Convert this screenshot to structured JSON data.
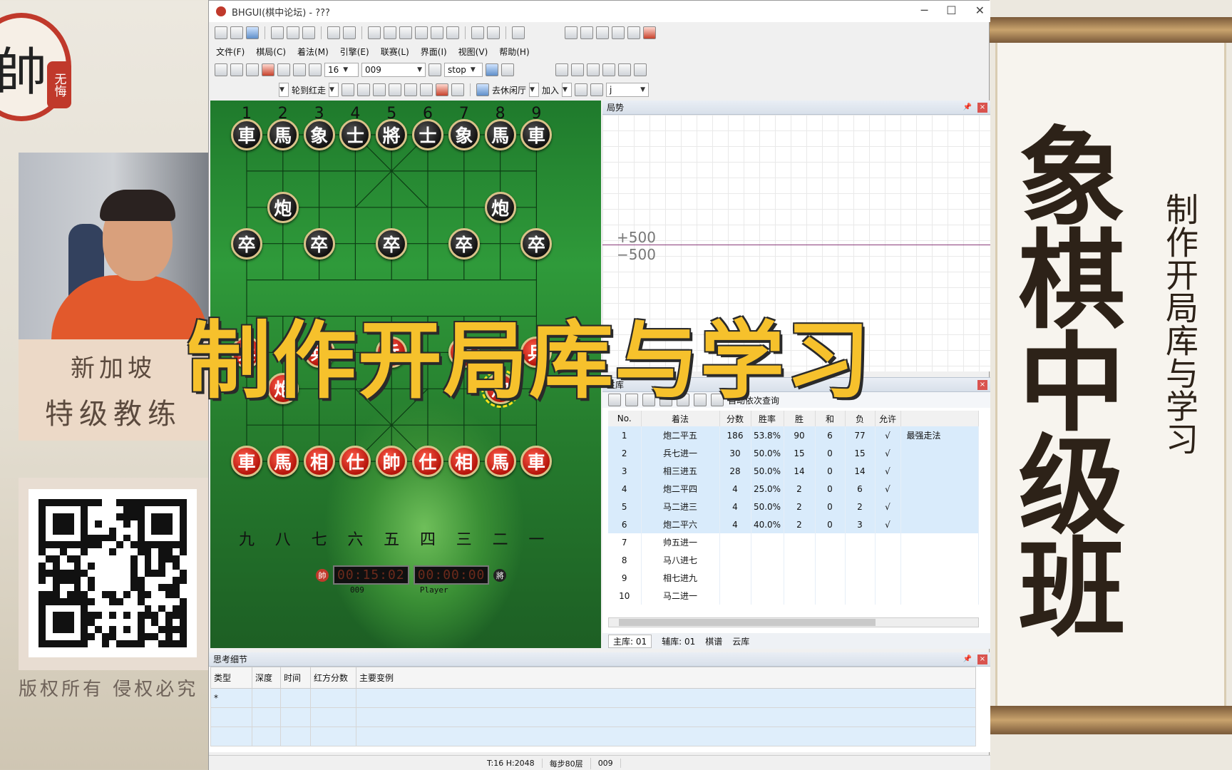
{
  "left": {
    "logo_char": "帥",
    "logo_seal": "无悔",
    "coach_line1": "新加坡",
    "coach_line2": "特级教练",
    "copyright": "版权所有 侵权必究"
  },
  "right": {
    "big_title": "象棋中级班",
    "subtitle": "制作开局库与学习"
  },
  "overlay": {
    "title": "制作开局库与学习"
  },
  "window": {
    "title": "BHGUI(棋中论坛) - ???",
    "controls": [
      "─",
      "☐",
      "✕"
    ],
    "menus": [
      "文件(F)",
      "棋局(C)",
      "着法(M)",
      "引擎(E)",
      "联赛(L)",
      "界面(I)",
      "视图(V)",
      "帮助(H)"
    ],
    "toolbar2": {
      "depth": "16",
      "engine": "009",
      "stop": "stop"
    },
    "toolbar3": {
      "turn": "轮到红走",
      "mode": "去休闲厅",
      "join": "加入",
      "extra": "j"
    }
  },
  "board": {
    "col_numbers": [
      "1",
      "2",
      "3",
      "4",
      "5",
      "6",
      "7",
      "8",
      "9"
    ],
    "col_chinese": [
      "九",
      "八",
      "七",
      "六",
      "五",
      "四",
      "三",
      "二",
      "一"
    ],
    "black_back": [
      "車",
      "馬",
      "象",
      "士",
      "將",
      "士",
      "象",
      "馬",
      "車"
    ],
    "black_cannon": "炮",
    "black_pawn": "卒",
    "red_back": [
      "車",
      "馬",
      "相",
      "仕",
      "帥",
      "仕",
      "相",
      "馬",
      "車"
    ],
    "red_cannon": "炮",
    "red_pawn": "兵"
  },
  "clock": {
    "red_badge": "帥",
    "black_badge": "將",
    "red_time": "00:15:02",
    "black_time": "00:00:00",
    "red_player": "009",
    "black_player": "Player"
  },
  "trend": {
    "header": "局势",
    "plus": "+500",
    "minus": "−500"
  },
  "book": {
    "header": "主库",
    "auto_label": "自动依次查询",
    "columns": [
      "No.",
      "着法",
      "分数",
      "胜率",
      "胜",
      "和",
      "负",
      "允许",
      ""
    ],
    "rows": [
      {
        "no": "1",
        "move": "炮二平五",
        "score": "186",
        "rate": "53.8%",
        "win": "90",
        "draw": "6",
        "loss": "77",
        "allow": "√",
        "note": "最强走法"
      },
      {
        "no": "2",
        "move": "兵七进一",
        "score": "30",
        "rate": "50.0%",
        "win": "15",
        "draw": "0",
        "loss": "15",
        "allow": "√",
        "note": ""
      },
      {
        "no": "3",
        "move": "相三进五",
        "score": "28",
        "rate": "50.0%",
        "win": "14",
        "draw": "0",
        "loss": "14",
        "allow": "√",
        "note": ""
      },
      {
        "no": "4",
        "move": "炮二平四",
        "score": "4",
        "rate": "25.0%",
        "win": "2",
        "draw": "0",
        "loss": "6",
        "allow": "√",
        "note": ""
      },
      {
        "no": "5",
        "move": "马二进三",
        "score": "4",
        "rate": "50.0%",
        "win": "2",
        "draw": "0",
        "loss": "2",
        "allow": "√",
        "note": ""
      },
      {
        "no": "6",
        "move": "炮二平六",
        "score": "4",
        "rate": "40.0%",
        "win": "2",
        "draw": "0",
        "loss": "3",
        "allow": "√",
        "note": ""
      },
      {
        "no": "7",
        "move": "帅五进一",
        "score": "",
        "rate": "",
        "win": "",
        "draw": "",
        "loss": "",
        "allow": "",
        "note": ""
      },
      {
        "no": "8",
        "move": "马八进七",
        "score": "",
        "rate": "",
        "win": "",
        "draw": "",
        "loss": "",
        "allow": "",
        "note": ""
      },
      {
        "no": "9",
        "move": "相七进九",
        "score": "",
        "rate": "",
        "win": "",
        "draw": "",
        "loss": "",
        "allow": "",
        "note": ""
      },
      {
        "no": "10",
        "move": "马二进一",
        "score": "",
        "rate": "",
        "win": "",
        "draw": "",
        "loss": "",
        "allow": "",
        "note": ""
      }
    ],
    "tabs": [
      "主库: 01",
      "辅库: 01",
      "棋谱",
      "云库"
    ]
  },
  "think": {
    "header": "思考细节",
    "columns": [
      "类型",
      "深度",
      "时间",
      "红方分数",
      "主要变例"
    ],
    "first_cell": "*"
  },
  "status": {
    "hash": "T:16 H:2048",
    "moves": "每步80层",
    "engine": "009"
  }
}
